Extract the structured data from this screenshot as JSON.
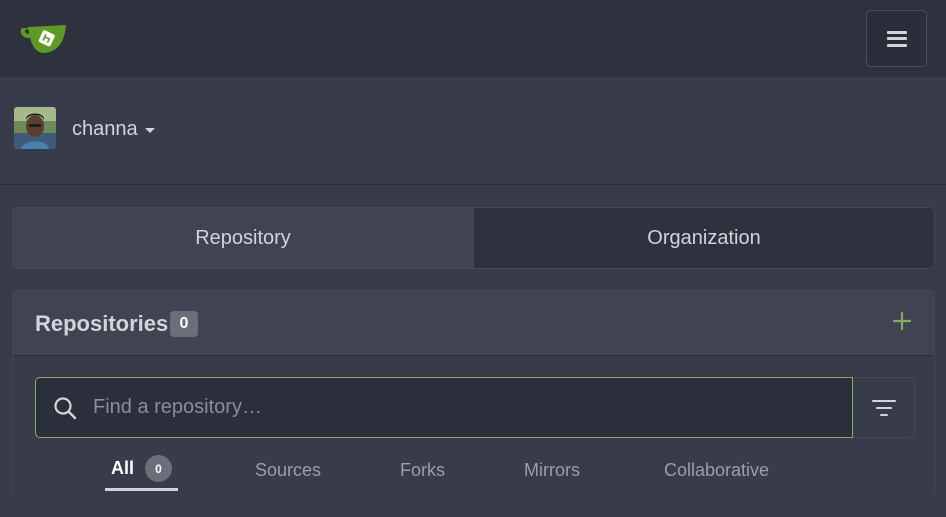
{
  "navbar": {
    "logo_icon": "gitea-tea-cup-logo-icon",
    "menu_icon": "hamburger-menu-icon"
  },
  "user": {
    "name": "channa",
    "caret_icon": "caret-down-icon"
  },
  "switcher": {
    "repository_label": "Repository",
    "organization_label": "Organization"
  },
  "repos_panel": {
    "title": "Repositories",
    "count": "0",
    "add_icon": "plus-icon",
    "accent_color": "#87ab63",
    "search": {
      "placeholder": "Find a repository…",
      "value": ""
    },
    "search_icon": "search-icon",
    "filter_icon": "filter-icon",
    "tabs": [
      {
        "label": "All",
        "count": "0",
        "active": true
      },
      {
        "label": "Sources"
      },
      {
        "label": "Forks"
      },
      {
        "label": "Mirrors"
      },
      {
        "label": "Collaborative"
      }
    ]
  }
}
